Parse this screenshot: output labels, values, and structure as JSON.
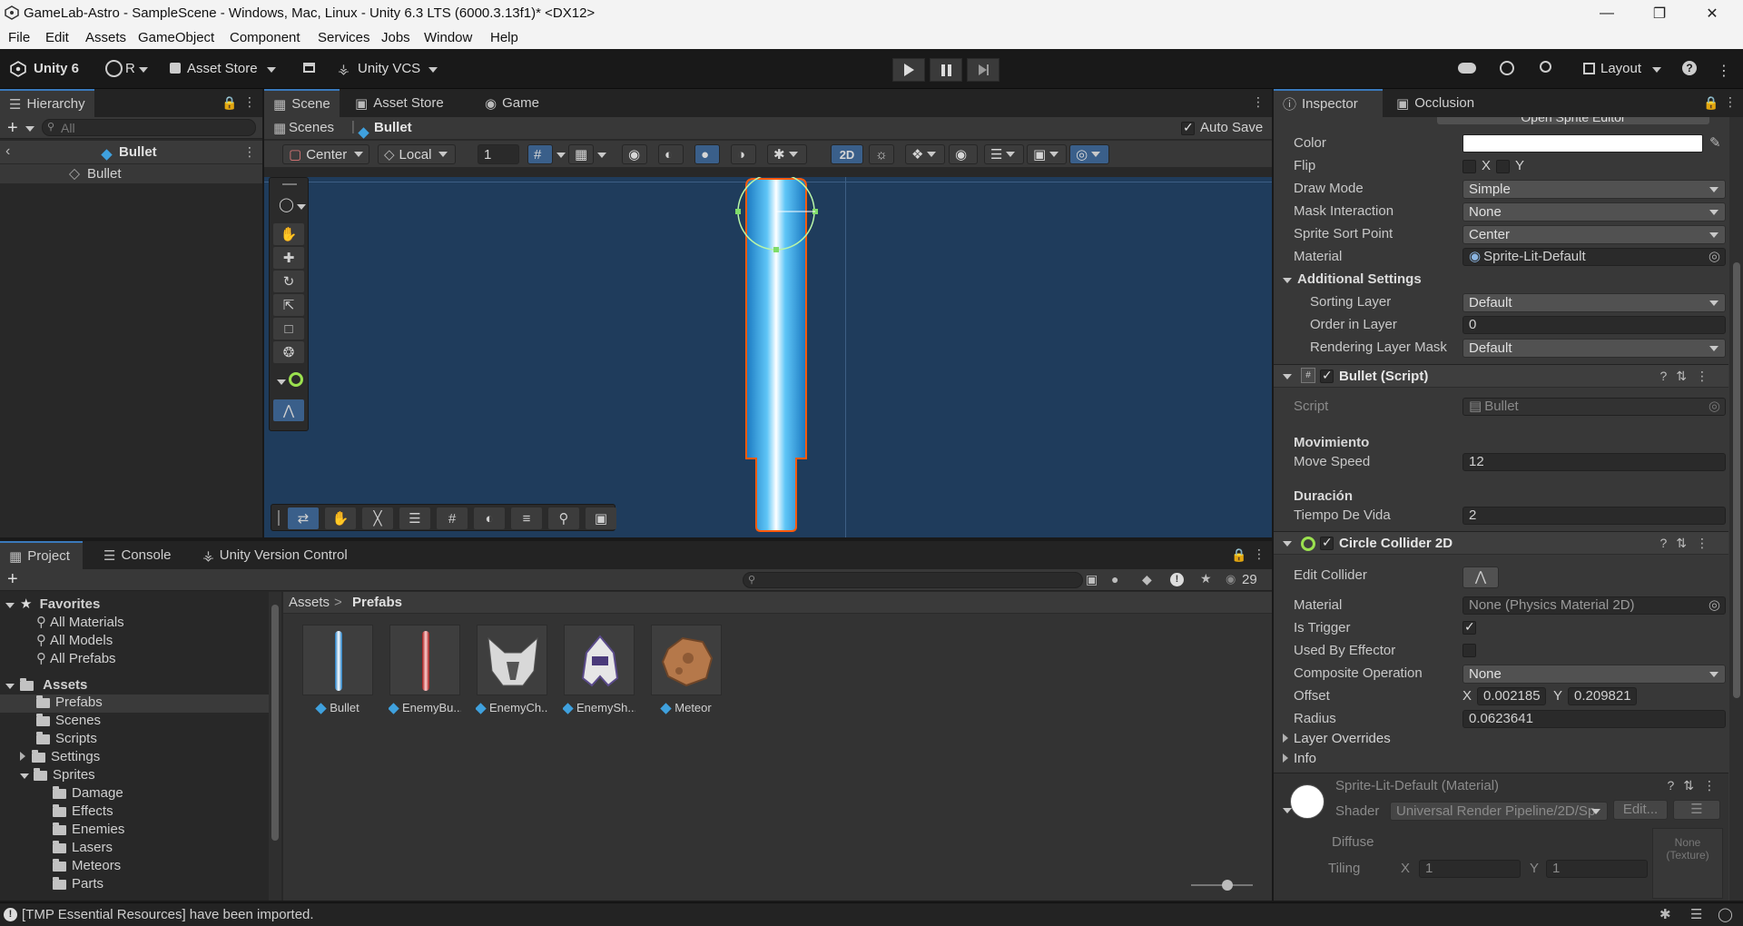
{
  "window": {
    "title": "GameLab-Astro - SampleScene - Windows, Mac, Linux - Unity 6.3 LTS (6000.3.13f1)* <DX12>"
  },
  "menu": [
    "File",
    "Edit",
    "Assets",
    "GameObject",
    "Component",
    "Services",
    "Jobs",
    "Window",
    "Help"
  ],
  "toolbar": {
    "unity": "Unity 6",
    "account": "R",
    "asset_store": "Asset Store",
    "vcs": "Unity VCS",
    "layout": "Layout"
  },
  "hierarchy": {
    "tab": "Hierarchy",
    "search_placeholder": "All",
    "prefab_root": "Bullet",
    "items": [
      "Bullet"
    ]
  },
  "scene": {
    "tabs": [
      "Scene",
      "Asset Store",
      "Game"
    ],
    "breadcrumb": [
      "Scenes",
      "Bullet"
    ],
    "auto_save": "Auto Save",
    "pivot": "Center",
    "space": "Local",
    "grid_size": "1",
    "mode_2d": "2D"
  },
  "project": {
    "tabs": [
      "Project",
      "Console",
      "Unity Version Control"
    ],
    "count": "29",
    "breadcrumb": [
      "Assets",
      "Prefabs"
    ],
    "favorites": {
      "label": "Favorites",
      "items": [
        "All Materials",
        "All Models",
        "All Prefabs"
      ]
    },
    "assets_label": "Assets",
    "folders": [
      "Prefabs",
      "Scenes",
      "Scripts",
      "Settings",
      "Sprites"
    ],
    "sprite_folders": [
      "Damage",
      "Effects",
      "Enemies",
      "Lasers",
      "Meteors",
      "Parts"
    ],
    "assets": [
      "Bullet",
      "EnemyBu...",
      "EnemyCh...",
      "EnemySh...",
      "Meteor"
    ]
  },
  "inspector": {
    "tabs": [
      "Inspector",
      "Occlusion"
    ],
    "sprite_editor": "Open Sprite Editor",
    "sprite_renderer": {
      "color_label": "Color",
      "flip_label": "Flip",
      "flip_x": "X",
      "flip_y": "Y",
      "draw_mode_label": "Draw Mode",
      "draw_mode": "Simple",
      "mask_label": "Mask Interaction",
      "mask": "None",
      "sort_point_label": "Sprite Sort Point",
      "sort_point": "Center",
      "material_label": "Material",
      "material": "Sprite-Lit-Default",
      "additional": "Additional Settings",
      "sorting_layer_label": "Sorting Layer",
      "sorting_layer": "Default",
      "order_label": "Order in Layer",
      "order": "0",
      "rendering_mask_label": "Rendering Layer Mask",
      "rendering_mask": "Default"
    },
    "bullet_script": {
      "title": "Bullet (Script)",
      "script_label": "Script",
      "script": "Bullet",
      "section1": "Movimiento",
      "speed_label": "Move Speed",
      "speed": "12",
      "section2": "Duración",
      "life_label": "Tiempo De Vida",
      "life": "2"
    },
    "circle_collider": {
      "title": "Circle Collider 2D",
      "edit_label": "Edit Collider",
      "material_label": "Material",
      "material": "None (Physics Material 2D)",
      "trigger_label": "Is Trigger",
      "effector_label": "Used By Effector",
      "composite_label": "Composite Operation",
      "composite": "None",
      "offset_label": "Offset",
      "offset_x_label": "X",
      "offset_x": "0.002185",
      "offset_y_label": "Y",
      "offset_y": "0.209821",
      "radius_label": "Radius",
      "radius": "0.0623641",
      "layer_overrides": "Layer Overrides",
      "info": "Info"
    },
    "material": {
      "title": "Sprite-Lit-Default (Material)",
      "shader_label": "Shader",
      "shader": "Universal Render Pipeline/2D/Sp",
      "edit": "Edit...",
      "diffuse": "Diffuse",
      "none_texture": "None",
      "texture": "(Texture)",
      "tiling": "Tiling",
      "tiling_x_label": "X",
      "tiling_x": "1",
      "tiling_y_label": "Y",
      "tiling_y": "1"
    }
  },
  "status": {
    "message": "[TMP Essential Resources] have been imported."
  }
}
